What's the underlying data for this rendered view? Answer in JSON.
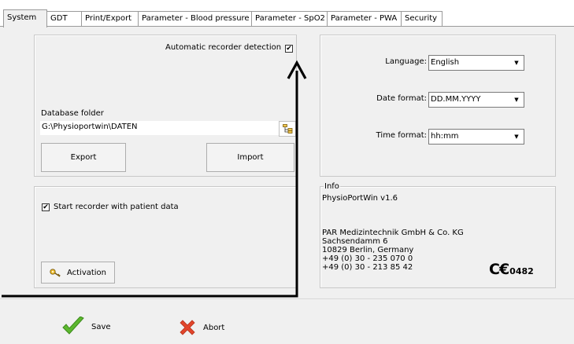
{
  "tabs": [
    {
      "label": "System",
      "active": true
    },
    {
      "label": "GDT"
    },
    {
      "label": "Print/Export"
    },
    {
      "label": "Parameter - Blood pressure"
    },
    {
      "label": "Parameter - SpO2"
    },
    {
      "label": "Parameter - PWA"
    },
    {
      "label": "Security"
    }
  ],
  "recorder": {
    "auto_detect_label": "Automatic recorder detection",
    "auto_detect_checked": true
  },
  "database": {
    "label": "Database folder",
    "path": "G:\\Physioportwin\\DATEN",
    "export_label": "Export",
    "import_label": "Import"
  },
  "patient": {
    "start_label": "Start recorder with patient data",
    "start_checked": true,
    "activation_label": "Activation"
  },
  "settings": {
    "language_label": "Language:",
    "language_value": "English",
    "date_label": "Date format:",
    "date_value": "DD.MM.YYYY",
    "time_label": "Time format:",
    "time_value": "hh:mm"
  },
  "info": {
    "legend": "Info",
    "version": "PhysioPortWin v1.6",
    "company": "PAR Medizintechnik GmbH & Co. KG",
    "street": "Sachsendamm 6",
    "city": "10829 Berlin, Germany",
    "phone": "+49 (0) 30 - 235 070 0",
    "fax": "+49 (0) 30 - 213 85 42",
    "ce_mark": "C€",
    "ce_number": "0482"
  },
  "footer": {
    "save_label": "Save",
    "abort_label": "Abort"
  },
  "colors": {
    "panel_bg": "#f0f0f0",
    "save_green": "#5cb82e",
    "abort_red": "#e2452b"
  }
}
